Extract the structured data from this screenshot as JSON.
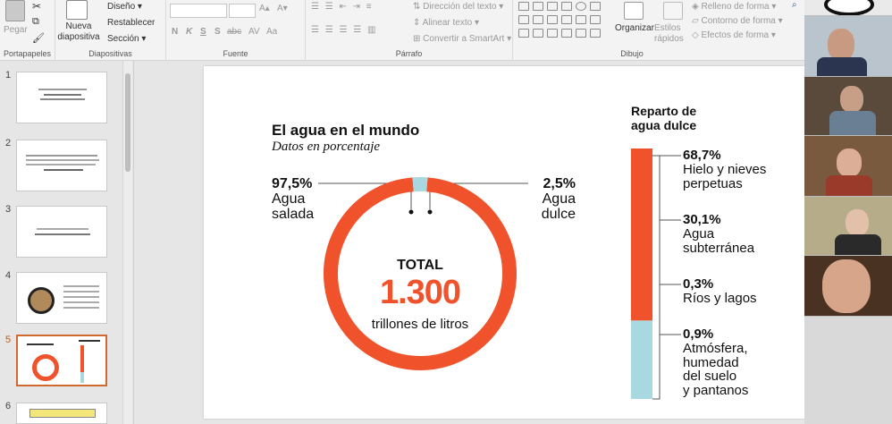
{
  "ribbon": {
    "clipboard": {
      "paste_label": "Pegar",
      "group_label": "Portapapeles"
    },
    "slides": {
      "new_slide_label": "Nueva diapositiva",
      "layout": "Diseño",
      "reset": "Restablecer",
      "section": "Sección",
      "group_label": "Diapositivas"
    },
    "font": {
      "bold": "N",
      "italic": "K",
      "underline": "S",
      "strike": "S",
      "abc": "abc",
      "aa": "AV",
      "aa2": "Aa",
      "group_label": "Fuente"
    },
    "paragraph": {
      "text_direction": "Dirección del texto",
      "align_text": "Alinear texto",
      "smartart": "Convertir a SmartArt",
      "group_label": "Párrafo"
    },
    "drawing": {
      "arrange": "Organizar",
      "quick_styles": "Estilos rápidos",
      "fill": "Relleno de forma",
      "outline": "Contorno de forma",
      "effects": "Efectos de forma",
      "group_label": "Dibujo"
    }
  },
  "thumbnails": [
    {
      "num": "1"
    },
    {
      "num": "2"
    },
    {
      "num": "3"
    },
    {
      "num": "4"
    },
    {
      "num": "5"
    },
    {
      "num": "6"
    }
  ],
  "slide": {
    "title": "El agua en el mundo",
    "subtitle": "Datos en porcentaje",
    "salt_pct": "97,5%",
    "salt_label_1": "Agua",
    "salt_label_2": "salada",
    "fresh_pct": "2,5%",
    "fresh_label_1": "Agua",
    "fresh_label_2": "dulce",
    "total_label": "TOTAL",
    "total_value": "1.300",
    "total_unit": "trillones de litros",
    "right_title_1": "Reparto de",
    "right_title_2": "agua dulce",
    "items": [
      {
        "pct": "68,7%",
        "lines": [
          "Hielo y nieves",
          "perpetuas"
        ]
      },
      {
        "pct": "30,1%",
        "lines": [
          "Agua",
          "subterránea"
        ]
      },
      {
        "pct": "0,3%",
        "lines": [
          "Ríos y lagos"
        ]
      },
      {
        "pct": "0,9%",
        "lines": [
          "Atmósfera,",
          "humedad",
          "del suelo",
          "y pantanos"
        ]
      }
    ],
    "colors": {
      "salt": "#f0532c",
      "fresh": "#a8d8e0"
    }
  },
  "chart_data": {
    "type": "pie",
    "categories": [
      "Agua salada",
      "Agua dulce"
    ],
    "values": [
      97.5,
      2.5
    ],
    "title": "El agua en el mundo",
    "subtitle": "Datos en porcentaje"
  },
  "fresh_breakdown": {
    "type": "bar",
    "categories": [
      "Hielo y nieves perpetuas",
      "Agua subterránea",
      "Ríos y lagos",
      "Atmósfera, humedad del suelo y pantanos"
    ],
    "values": [
      68.7,
      30.1,
      0.3,
      0.9
    ],
    "title": "Reparto de agua dulce"
  }
}
